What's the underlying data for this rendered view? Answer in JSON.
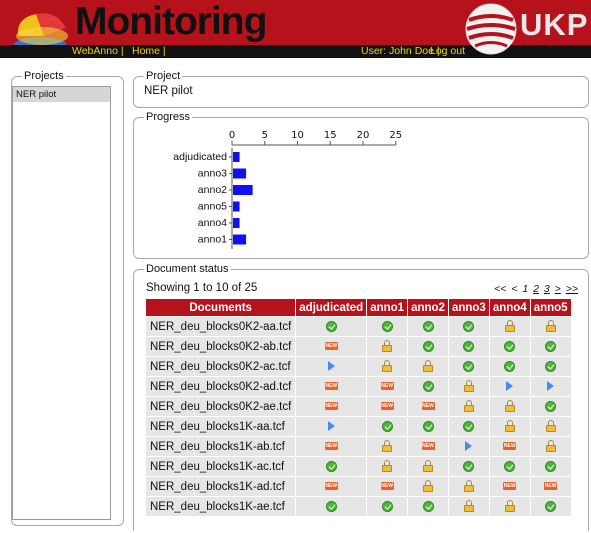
{
  "header": {
    "title": "Monitoring",
    "nav": {
      "webanno": "WebAnno |",
      "home": "Home |"
    },
    "user": {
      "label": "User: John Doe |",
      "logout": "Log out"
    },
    "brand": "UKP"
  },
  "projects_panel": {
    "legend": "Projects",
    "items": [
      "NER pilot"
    ]
  },
  "project_panel": {
    "legend": "Project",
    "name": "NER pilot"
  },
  "progress_panel": {
    "legend": "Progress",
    "chart_data": {
      "type": "bar",
      "orientation": "horizontal",
      "categories": [
        "adjudicated",
        "anno3",
        "anno2",
        "anno5",
        "anno4",
        "anno1"
      ],
      "values": [
        1,
        2,
        3,
        1,
        1,
        2
      ],
      "xticks": [
        0,
        5,
        10,
        15,
        20,
        25
      ],
      "xlim": [
        0,
        25
      ],
      "bar_color": "#1010f0"
    }
  },
  "document_status": {
    "legend": "Document status",
    "showing": "Showing 1 to 10 of 25",
    "pager": {
      "first": "<<",
      "prev": "<",
      "pages": [
        "1",
        "2",
        "3"
      ],
      "next": ">",
      "last": ">>"
    },
    "columns": [
      "Documents",
      "adjudicated",
      "anno1",
      "anno2",
      "anno3",
      "anno4",
      "anno5"
    ],
    "rows": [
      {
        "doc": "NER_deu_blocks0K2-aa.tcf",
        "status": [
          "done",
          "done",
          "done",
          "done",
          "locked",
          "locked"
        ]
      },
      {
        "doc": "NER_deu_blocks0K2-ab.tcf",
        "status": [
          "new",
          "locked",
          "done",
          "done",
          "done",
          "done"
        ]
      },
      {
        "doc": "NER_deu_blocks0K2-ac.tcf",
        "status": [
          "in-progress",
          "locked",
          "locked",
          "done",
          "done",
          "done"
        ]
      },
      {
        "doc": "NER_deu_blocks0K2-ad.tcf",
        "status": [
          "new",
          "new",
          "done",
          "locked",
          "in-progress",
          "in-progress"
        ]
      },
      {
        "doc": "NER_deu_blocks0K2-ae.tcf",
        "status": [
          "new",
          "new",
          "new",
          "locked",
          "locked",
          "done"
        ]
      },
      {
        "doc": "NER_deu_blocks1K-aa.tcf",
        "status": [
          "in-progress",
          "done",
          "done",
          "done",
          "locked",
          "locked"
        ]
      },
      {
        "doc": "NER_deu_blocks1K-ab.tcf",
        "status": [
          "new",
          "locked",
          "new",
          "in-progress",
          "new",
          "locked"
        ]
      },
      {
        "doc": "NER_deu_blocks1K-ac.tcf",
        "status": [
          "done",
          "locked",
          "locked",
          "done",
          "done",
          "done"
        ]
      },
      {
        "doc": "NER_deu_blocks1K-ad.tcf",
        "status": [
          "new",
          "new",
          "locked",
          "locked",
          "new",
          "new"
        ]
      },
      {
        "doc": "NER_deu_blocks1K-ae.tcf",
        "status": [
          "done",
          "done",
          "done",
          "locked",
          "locked",
          "done"
        ]
      }
    ],
    "icon_labels": {
      "new": "NEW"
    }
  },
  "colors": {
    "header_red": "#b5121b",
    "nav_link_yellow": "#f5cf1a",
    "table_header_red": "#b5121b",
    "row_gray": "#e6e6e6",
    "done_green": "#4fb63a",
    "new_orange": "#e8632c",
    "lock_gold": "#f0bd3a",
    "inprogress_blue": "#4a8ae8"
  }
}
